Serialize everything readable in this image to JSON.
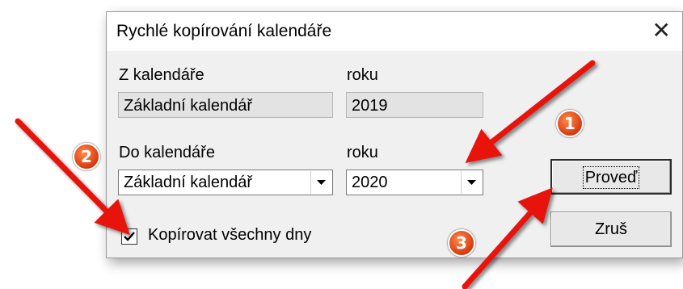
{
  "dialog": {
    "title": "Rychlé kopírování kalendáře",
    "close_glyph": "✕",
    "from_calendar_label": "Z kalendáře",
    "from_calendar_value": "Základní kalendář",
    "from_year_label": "roku",
    "from_year_value": "2019",
    "to_calendar_label": "Do kalendáře",
    "to_calendar_value": "Základní kalendář",
    "to_year_label": "roku",
    "to_year_value": "2020",
    "copy_all_days_label": "Kopírovat všechny dny",
    "copy_all_days_checked": true,
    "execute_button": "Proveď",
    "cancel_button": "Zruš"
  },
  "annotations": {
    "badge_1": "1",
    "badge_2": "2",
    "badge_3": "3",
    "arrow_color": "#e8140c"
  }
}
